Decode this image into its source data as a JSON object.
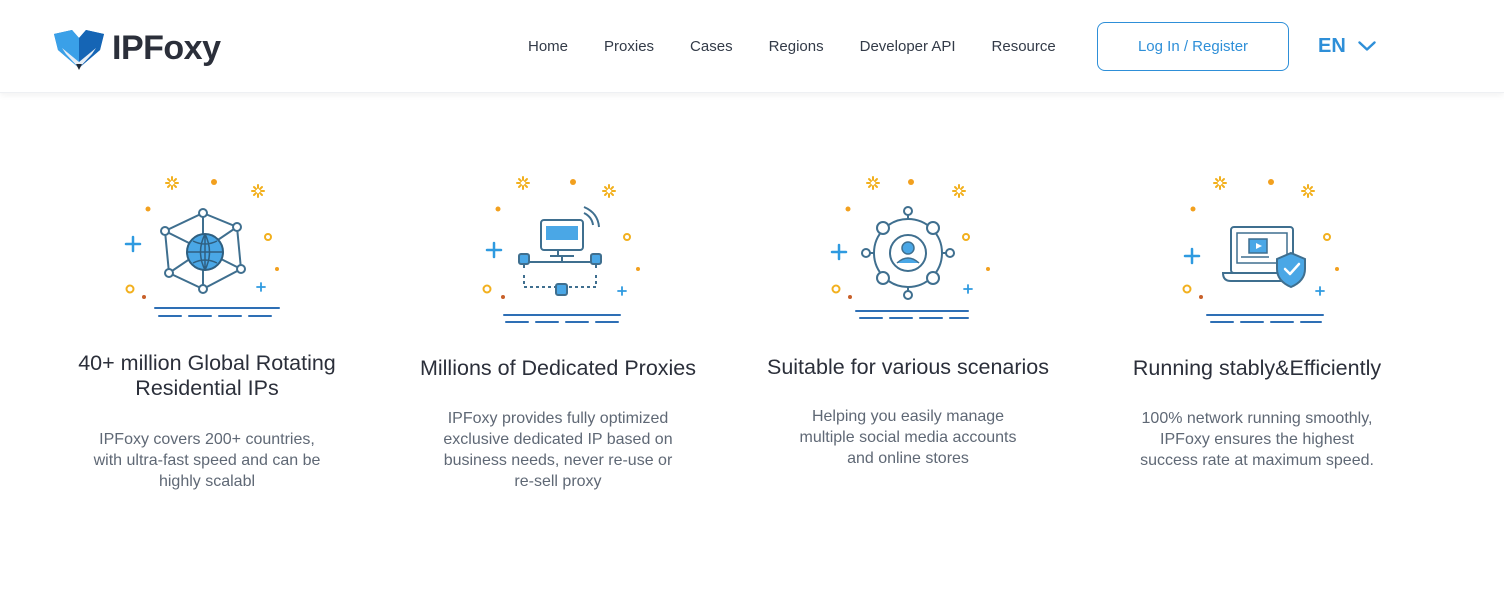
{
  "header": {
    "logo_text": "IPFoxy",
    "nav": [
      {
        "label": "Home"
      },
      {
        "label": "Proxies"
      },
      {
        "label": "Cases"
      },
      {
        "label": "Regions"
      },
      {
        "label": "Developer API"
      },
      {
        "label": "Resource"
      }
    ],
    "login_label": "Log In / Register",
    "language": "EN"
  },
  "colors": {
    "accent": "#2e8fd8",
    "illustration_stroke": "#3f6f8f",
    "illustration_fill": "#4aa7e6",
    "sparkle": "#f2b01e"
  },
  "features": [
    {
      "icon": "global-network-icon",
      "title": "40+ million Global Rotating Residential IPs",
      "description": "IPFoxy covers 200+ countries, with ultra-fast speed and can be highly scalabl"
    },
    {
      "icon": "dedicated-proxy-network-icon",
      "title": "Millions of Dedicated Proxies",
      "description": "IPFoxy provides fully optimized exclusive dedicated IP based on business needs, never re-use or re-sell proxy"
    },
    {
      "icon": "user-connection-hub-icon",
      "title": "Suitable for various scenarios",
      "description": "Helping you easily manage multiple social media accounts and online stores"
    },
    {
      "icon": "secure-laptop-icon",
      "title": "Running stably&Efficiently",
      "description": "100% network running smoothly, IPFoxy ensures the highest success rate at maximum speed."
    }
  ]
}
